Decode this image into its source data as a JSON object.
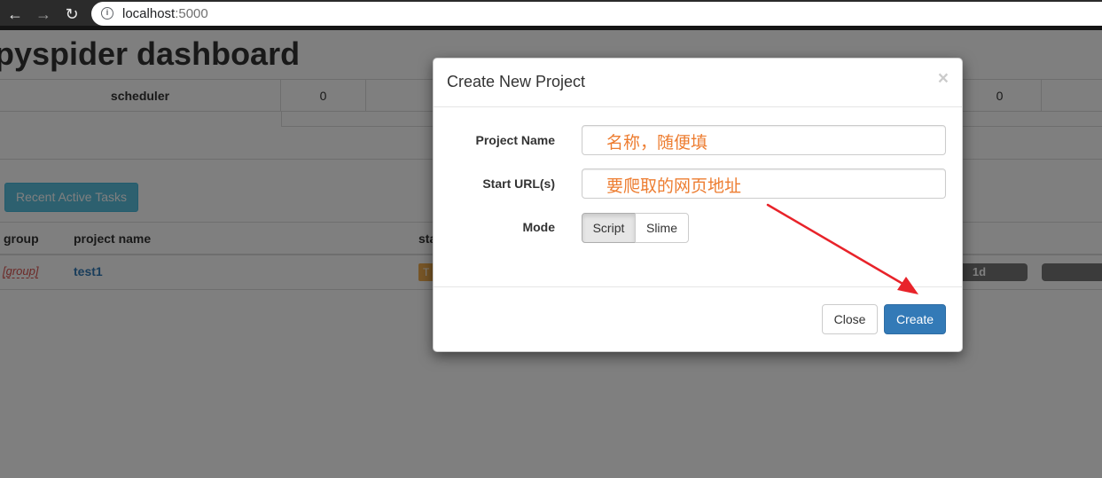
{
  "browser": {
    "url_host": "localhost",
    "url_port": ":5000",
    "icons": {
      "back": "back-arrow-icon",
      "forward": "forward-arrow-icon",
      "reload": "reload-icon",
      "info": "info-icon"
    }
  },
  "dashboard": {
    "title": "pyspider dashboard",
    "stats": {
      "label": "scheduler",
      "value_1": "0",
      "value_2": "0"
    },
    "recent_button": "Recent Active Tasks",
    "table": {
      "headers": [
        "group",
        "project name",
        "sta"
      ],
      "rows": [
        {
          "group": "[group]",
          "name": "test1",
          "status": "T",
          "progress_label": "1d"
        }
      ]
    }
  },
  "modal": {
    "title": "Create New Project",
    "close_symbol": "×",
    "fields": {
      "project_name": {
        "label": "Project Name",
        "annotation": "名称，随便填"
      },
      "start_urls": {
        "label": "Start URL(s)",
        "annotation": "要爬取的网页地址"
      },
      "mode": {
        "label": "Mode",
        "options": [
          "Script",
          "Slime"
        ],
        "selected": "Script"
      }
    },
    "footer": {
      "close_label": "Close",
      "create_label": "Create"
    }
  },
  "colors": {
    "primary": "#337ab7",
    "info": "#5bc0de",
    "warning": "#f0ad4e",
    "annotation": "#ed7d31",
    "arrow": "#e8232a"
  }
}
